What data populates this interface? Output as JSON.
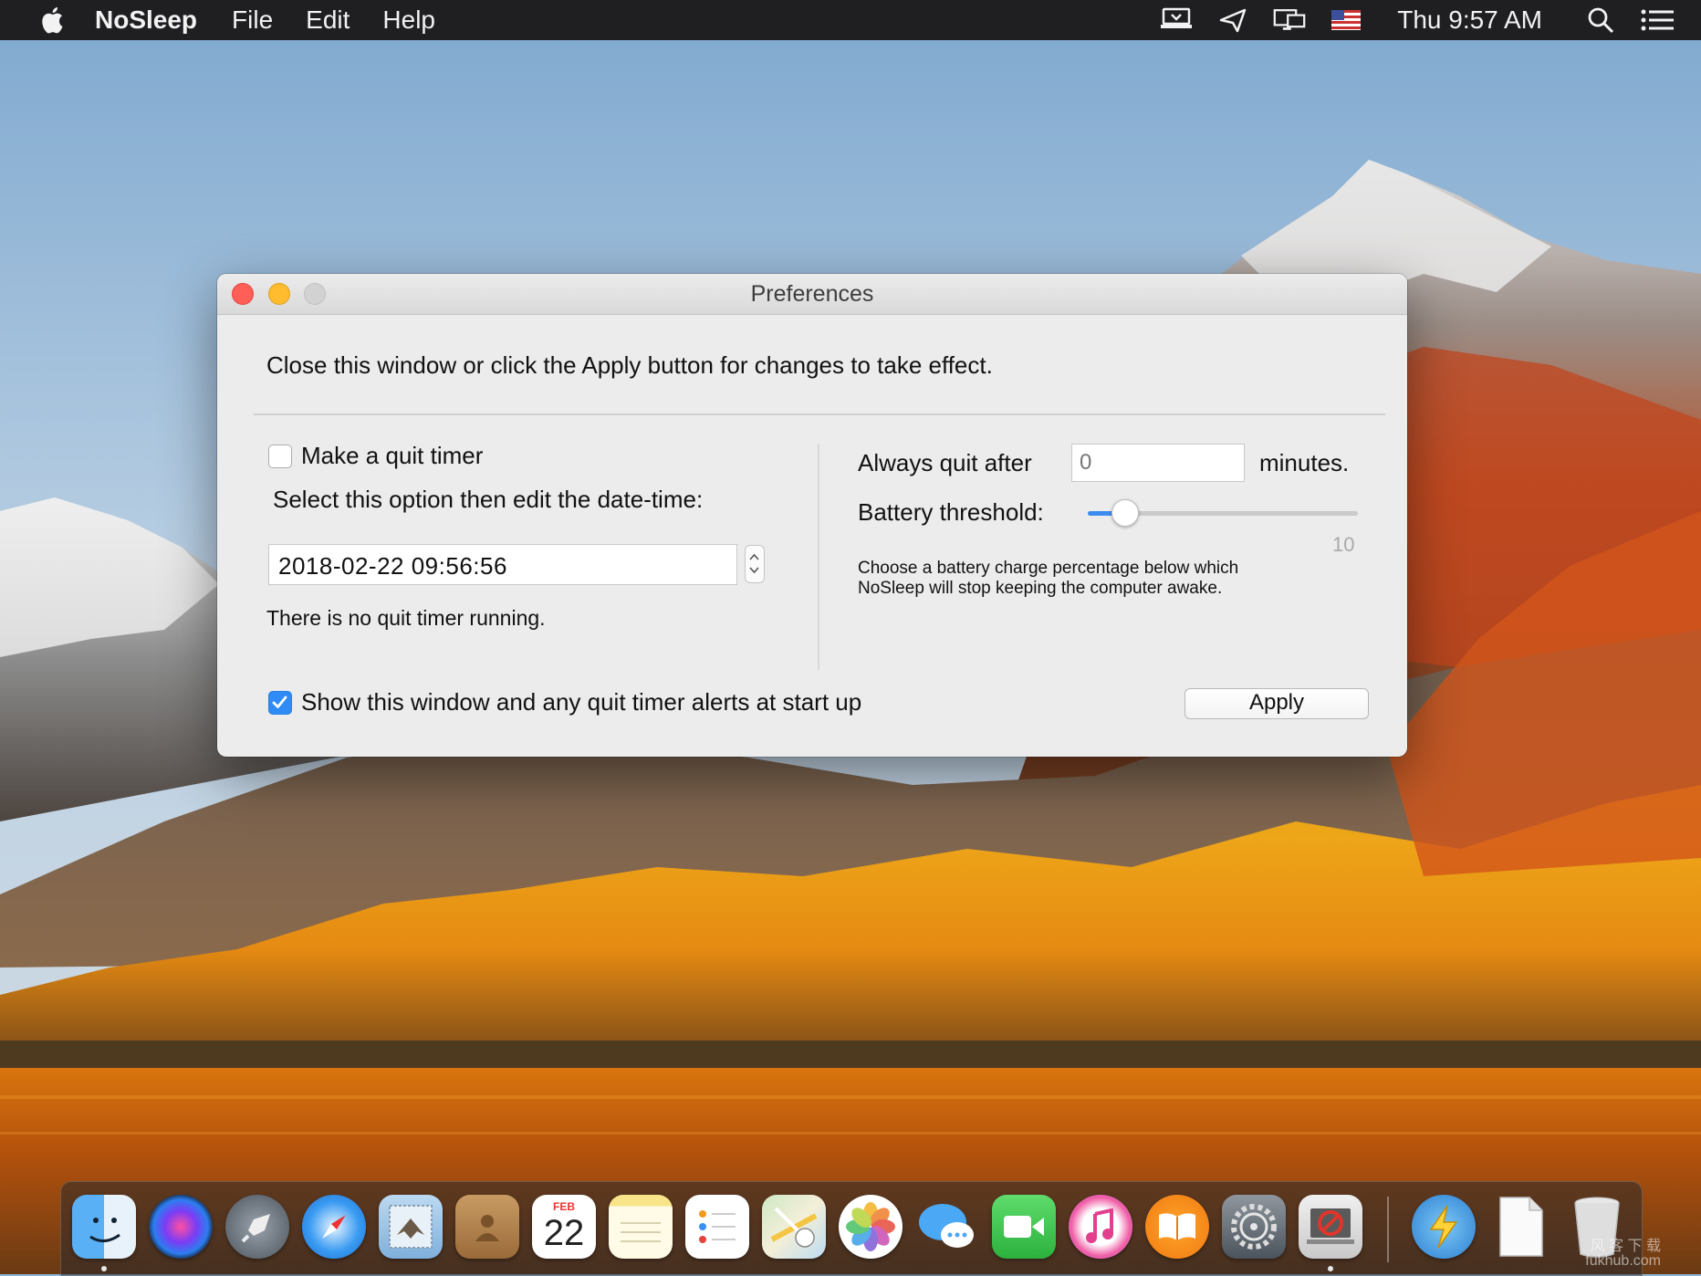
{
  "menubar": {
    "app_name": "NoSleep",
    "menus": [
      "File",
      "Edit",
      "Help"
    ],
    "clock": "Thu 9:57 AM",
    "status_icons": [
      "nosleep-status-icon",
      "airplane-icon",
      "display-mirroring-icon",
      "us-flag-input-icon",
      "spotlight-search-icon",
      "notification-center-icon"
    ]
  },
  "window": {
    "title": "Preferences",
    "notice": "Close this window or click the Apply button for changes to take effect.",
    "quit_timer": {
      "checkbox_label": "Make a quit timer",
      "checked": false,
      "instruction": "Select this option then edit the date-time:",
      "datetime_value": "2018-02-22 09:56:56",
      "status": "There is no quit timer running."
    },
    "always_quit": {
      "label": "Always quit after",
      "placeholder": "0",
      "unit": "minutes."
    },
    "battery": {
      "label": "Battery threshold:",
      "value": 10,
      "value_text": "10",
      "slider_fraction": 0.14,
      "description_line1": "Choose a battery charge percentage below which",
      "description_line2": "NoSleep will stop keeping the computer awake."
    },
    "startup": {
      "label": "Show this window and any quit timer alerts at start up",
      "checked": true
    },
    "apply_label": "Apply"
  },
  "dock": {
    "apps": [
      "Finder",
      "Siri",
      "Launchpad",
      "Safari",
      "Mail",
      "Contacts",
      "Calendar",
      "Notes",
      "Reminders",
      "Maps",
      "Photos",
      "Messages",
      "FaceTime",
      "iTunes",
      "iBooks",
      "System Preferences",
      "NoSleep",
      "Thunderbolt",
      "Document",
      "Trash"
    ],
    "calendar_month": "FEB",
    "calendar_day": "22"
  },
  "watermark": {
    "line1": "风 客 下 载",
    "line2": "fukhub.com"
  },
  "colors": {
    "accent": "#2f8bf5",
    "menubar": "#1f1f22",
    "window_bg": "#ececec",
    "close": "#ff5f57",
    "minimize": "#febc2e"
  }
}
